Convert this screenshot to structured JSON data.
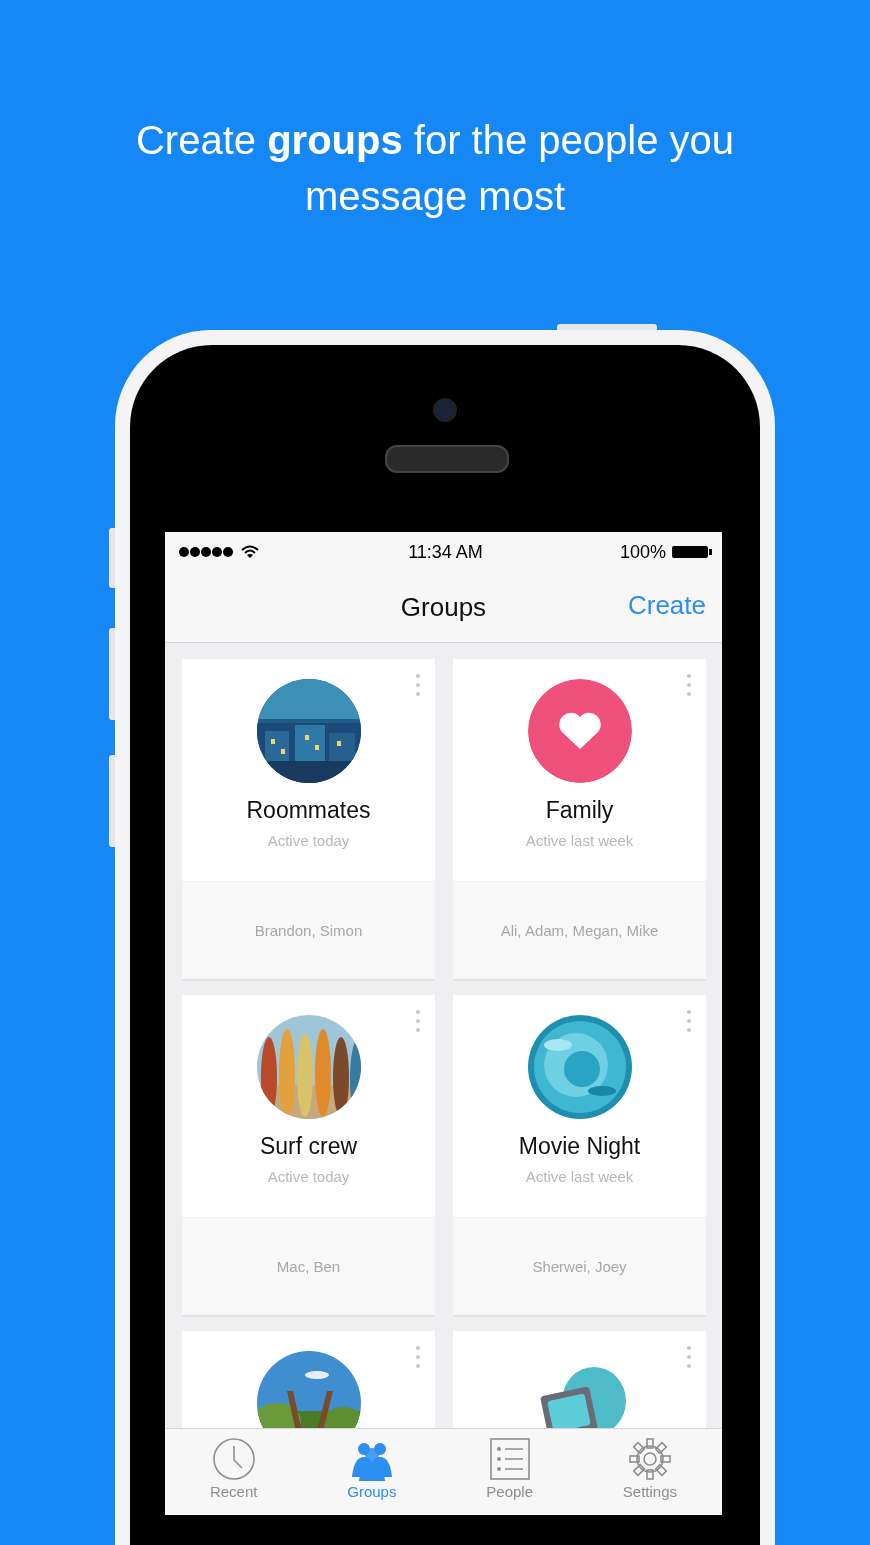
{
  "headline": "Create **groups** for the people you message most",
  "status_bar": {
    "time": "11:34 AM",
    "battery": "100%"
  },
  "nav": {
    "title": "Groups",
    "action": "Create"
  },
  "groups": [
    {
      "name": "Roommates",
      "activity": "Active today",
      "members": "Brandon, Simon",
      "kind": "picture"
    },
    {
      "name": "Family",
      "activity": "Active last week",
      "members": "Ali, Adam, Megan, Mike",
      "kind": "heart"
    },
    {
      "name": "Surf crew",
      "activity": "Active today",
      "members": "Mac, Ben",
      "kind": "picture"
    },
    {
      "name": "Movie Night",
      "activity": "Active last week",
      "members": "Sherwei, Joey",
      "kind": "picture"
    },
    {
      "kind": "picture"
    },
    {
      "kind": "illustration"
    }
  ],
  "tabs": [
    {
      "label": "Recent",
      "selected": false
    },
    {
      "label": "Groups",
      "selected": true
    },
    {
      "label": "People",
      "selected": false
    },
    {
      "label": "Settings",
      "selected": false
    }
  ]
}
